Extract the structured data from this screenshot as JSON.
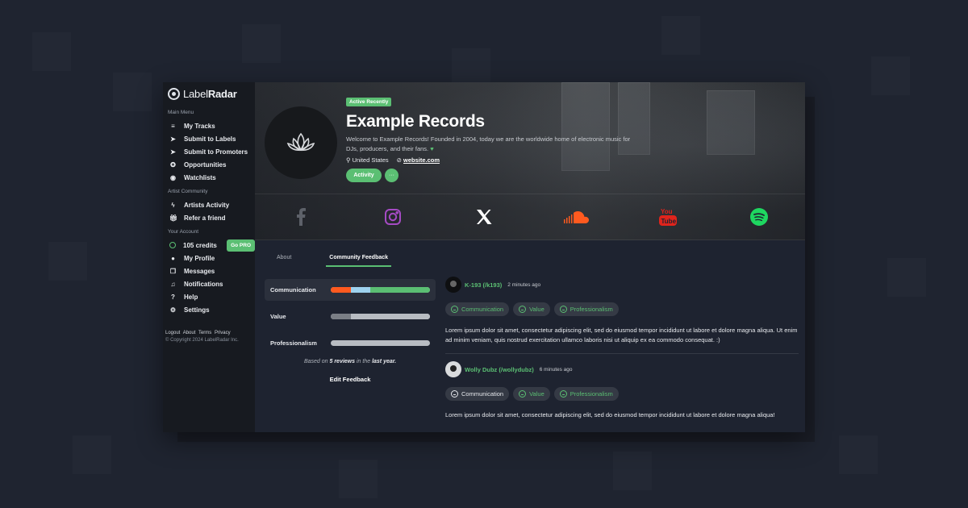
{
  "colors": {
    "accent": "#5bbf73",
    "sidebar_bg": "#171a20",
    "app_bg": "#1e2330"
  },
  "brand": {
    "name_light": "Label",
    "name_bold": "Radar"
  },
  "sidebar": {
    "main_menu_label": "Main Menu",
    "main_items": [
      {
        "label": "My Tracks",
        "icon": "playlist-icon"
      },
      {
        "label": "Submit to Labels",
        "icon": "send-icon"
      },
      {
        "label": "Submit to Promoters",
        "icon": "send-icon"
      },
      {
        "label": "Opportunities",
        "icon": "star-circle-icon"
      },
      {
        "label": "Watchlists",
        "icon": "eye-icon"
      }
    ],
    "community_label": "Artist Community",
    "community_items": [
      {
        "label": "Artists Activity",
        "icon": "bolt-icon"
      },
      {
        "label": "Refer a friend",
        "icon": "gift-icon"
      }
    ],
    "account_label": "Your Account",
    "credits": "105 credits",
    "go_pro": "Go PRO",
    "account_items": [
      {
        "label": "My Profile",
        "icon": "user-icon"
      },
      {
        "label": "Messages",
        "icon": "messages-icon"
      },
      {
        "label": "Notifications",
        "icon": "bell-icon"
      },
      {
        "label": "Help",
        "icon": "help-icon"
      },
      {
        "label": "Settings",
        "icon": "gear-icon"
      }
    ],
    "footer_links": [
      "Logout",
      "About",
      "Terms",
      "Privacy"
    ],
    "copyright": "© Copyright 2024 LabelRadar Inc."
  },
  "profile": {
    "status_badge": "Active Recently",
    "title": "Example Records",
    "description": "Welcome to Example Records! Founded in 2004, today we are the worldwide home of electronic music for DJs, producers, and their fans.",
    "location": "United States",
    "website": "website.com",
    "activity_button": "Activity",
    "more_button": "···"
  },
  "social": [
    {
      "name": "facebook-icon",
      "color": "#5d6169"
    },
    {
      "name": "instagram-icon",
      "color": "#a54bc4"
    },
    {
      "name": "x-icon",
      "color": "#ffffff"
    },
    {
      "name": "soundcloud-icon",
      "color": "#ff5a1f"
    },
    {
      "name": "youtube-icon",
      "color": "#e0241c"
    },
    {
      "name": "spotify-icon",
      "color": "#1ed760"
    }
  ],
  "tabs": {
    "about": "About",
    "community_feedback": "Community Feedback"
  },
  "ratings": {
    "items": [
      {
        "label": "Communication",
        "segments": [
          {
            "fraction": 0.2,
            "color": "#ff5a1f"
          },
          {
            "fraction": 0.2,
            "color": "#9fd3ef"
          },
          {
            "fraction": 0.6,
            "color": "#5bbf73"
          }
        ]
      },
      {
        "label": "Value",
        "segments": [
          {
            "fraction": 0.2,
            "color": "#7a7e85"
          },
          {
            "fraction": 0.8,
            "color": "#b8bcc2"
          }
        ]
      },
      {
        "label": "Professionalism",
        "segments": [
          {
            "fraction": 1.0,
            "color": "#b8bcc2"
          }
        ]
      }
    ],
    "based_on_prefix": "Based on",
    "based_on_count": "5 reviews",
    "based_on_mid": "in the",
    "based_on_period": "last year.",
    "edit_feedback": "Edit Feedback"
  },
  "feedback": [
    {
      "user": "K-193 (/k193)",
      "time": "2 minutes ago",
      "chips": [
        {
          "label": "Communication",
          "tone": "positive"
        },
        {
          "label": "Value",
          "tone": "positive"
        },
        {
          "label": "Professionalism",
          "tone": "positive"
        }
      ],
      "text": "Lorem ipsum dolor sit amet, consectetur adipiscing elit, sed do eiusmod tempor incididunt ut labore et dolore magna aliqua. Ut enim ad minim veniam, quis nostrud exercitation ullamco laboris nisi ut aliquip ex ea commodo consequat. :)"
    },
    {
      "user": "Wolly Dubz (/wollydubz)",
      "time": "6 minutes ago",
      "chips": [
        {
          "label": "Communication",
          "tone": "neutral"
        },
        {
          "label": "Value",
          "tone": "positive"
        },
        {
          "label": "Professionalism",
          "tone": "positive"
        }
      ],
      "text": "Lorem ipsum dolor sit amet, consectetur adipiscing elit, sed do eiusmod tempor incididunt ut labore et dolore magna aliqua!"
    }
  ]
}
